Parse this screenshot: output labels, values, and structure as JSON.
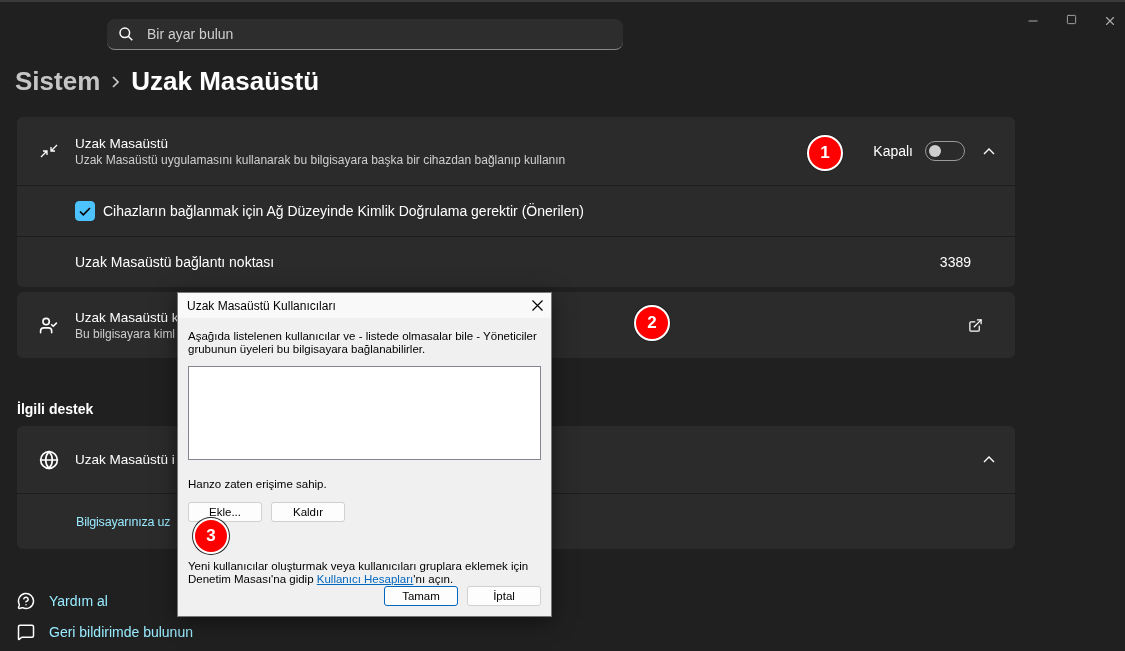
{
  "search": {
    "placeholder": "Bir ayar bulun"
  },
  "breadcrumb": {
    "parent": "Sistem",
    "current": "Uzak Masaüstü"
  },
  "remote_desktop": {
    "title": "Uzak Masaüstü",
    "description": "Uzak Masaüstü uygulamasını kullanarak bu bilgisayara başka bir cihazdan bağlanıp kullanın",
    "status": "Kapalı",
    "on": false,
    "expanded": true,
    "checkbox": {
      "label": "Cihazların bağlanmak için Ağ Düzeyinde Kimlik Doğrulama gerektir (Önerilen)",
      "checked": true
    },
    "port": {
      "label": "Uzak Masaüstü bağlantı noktası",
      "value": "3389"
    }
  },
  "users_card": {
    "title": "Uzak Masaüstü k",
    "description": "Bu bilgisayara kiml"
  },
  "related_support": {
    "heading": "İlgili destek",
    "title": "Uzak Masaüstü i",
    "expanded": true,
    "link": "Bilgisayarınıza uz"
  },
  "footer_links": [
    {
      "kind": "help",
      "label": "Yardım al"
    },
    {
      "kind": "feedback",
      "label": "Geri bildirimde bulunun"
    }
  ],
  "dialog": {
    "title": "Uzak Masaüstü Kullanıcıları",
    "intro": "Aşağıda listelenen kullanıcılar ve - listede olmasalar bile - Yöneticiler grubunun üyeleri bu bilgisayara bağlanabilirler.",
    "access_note": "Hanzo zaten erişime sahip.",
    "list_buttons": [
      "Ekle...",
      "Kaldır"
    ],
    "hint_before": "Yeni kullanıcılar oluşturmak veya kullanıcıları gruplara eklemek için Denetim Masası'na gidip",
    "hint_link": "Kullanıcı Hesapları",
    "hint_after": "'nı açın.",
    "buttons": [
      {
        "label": "Tamam",
        "selected": true
      },
      {
        "label": "İptal",
        "selected": false
      }
    ]
  },
  "markers": [
    "1",
    "2",
    "3"
  ]
}
